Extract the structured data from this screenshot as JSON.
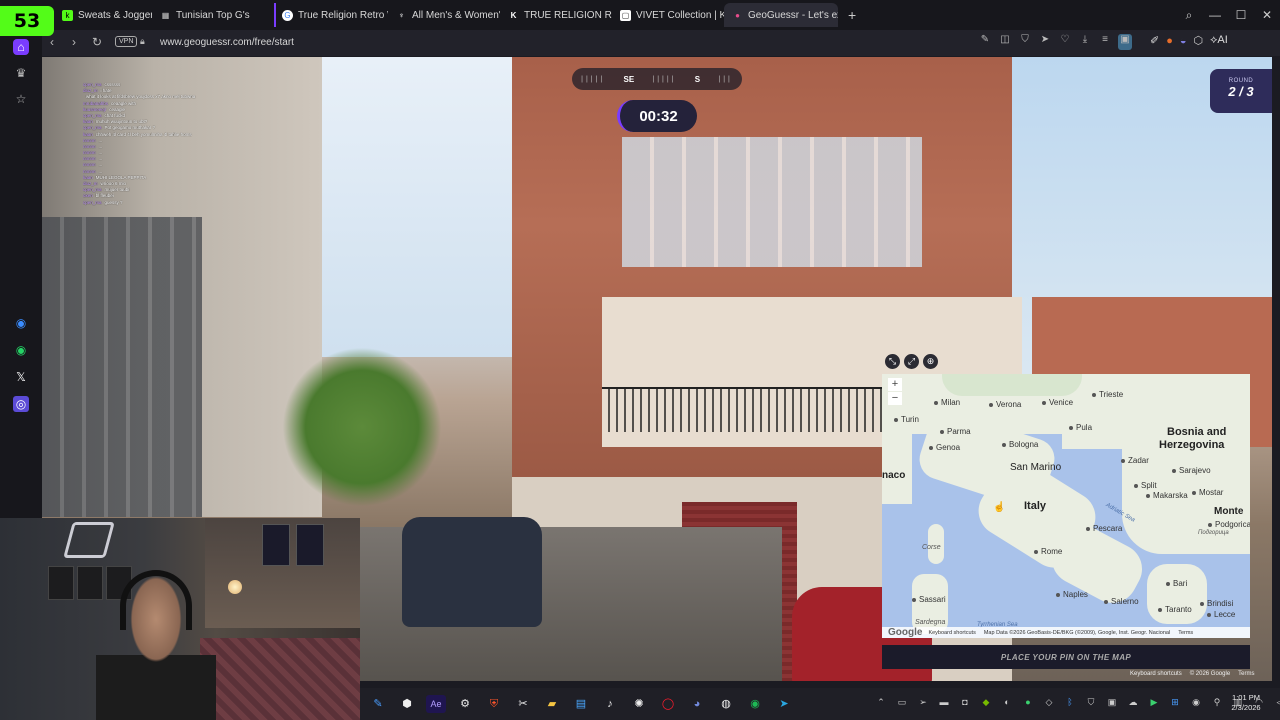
{
  "browser": {
    "badge": "53",
    "tabs": [
      {
        "label": "Sweats & Joggers",
        "icon": "kick-icon",
        "active": false
      },
      {
        "label": "Tunisian Top G's",
        "icon": "grid-icon",
        "active": false
      },
      {
        "label": "True Religion Retro Wool",
        "icon": "google-icon",
        "active": false
      },
      {
        "label": "All Men's & Women's Clot",
        "icon": "shop-icon",
        "active": false
      },
      {
        "label": "TRUE RELIGION Retro Wo",
        "icon": "k-icon",
        "active": false
      },
      {
        "label": "VIVET Collection | Kai Cen",
        "icon": "store-icon",
        "active": false
      },
      {
        "label": "GeoGuessr - Let's expl",
        "icon": "geoguessr-icon",
        "active": true
      }
    ],
    "new_tab": "+",
    "vpn": "VPN",
    "url": "www.geoguessr.com/free/start",
    "ai_label": "AI"
  },
  "game": {
    "compass_left": "SE",
    "compass_right": "S",
    "timer": "00:32",
    "round_label": "ROUND",
    "round_value": "2 / 3",
    "place_pin": "PLACE YOUR PIN ON THE MAP",
    "sv_footer": [
      "Keyboard shortcuts",
      "© 2026 Google",
      "Terms"
    ]
  },
  "map": {
    "zoom_in": "+",
    "zoom_out": "−",
    "cities": [
      {
        "name": "Milan"
      },
      {
        "name": "Verona"
      },
      {
        "name": "Venice"
      },
      {
        "name": "Trieste"
      },
      {
        "name": "Turin"
      },
      {
        "name": "Parma"
      },
      {
        "name": "Bologna"
      },
      {
        "name": "Genoa"
      },
      {
        "name": "Pula"
      },
      {
        "name": "Zadar"
      },
      {
        "name": "Sarajevo"
      },
      {
        "name": "Split"
      },
      {
        "name": "Makarska"
      },
      {
        "name": "Mostar"
      },
      {
        "name": "Pescara"
      },
      {
        "name": "Rome"
      },
      {
        "name": "Bari"
      },
      {
        "name": "Naples"
      },
      {
        "name": "Salerno"
      },
      {
        "name": "Sassari"
      },
      {
        "name": "Brindisi"
      },
      {
        "name": "Lecce"
      },
      {
        "name": "Taranto"
      },
      {
        "name": "Podgorica"
      }
    ],
    "labels": {
      "san_marino": "San Marino",
      "italy": "Italy",
      "bosnia": "Bosnia and",
      "herzegovina": "Herzegovina",
      "monte": "Monte",
      "naco": "naco",
      "corse": "Corse",
      "sardegna": "Sardegna",
      "adriatic": "Adriatic Sea",
      "tyrrhenian": "Tyrrhenian Sea",
      "podgorica_cyr": "Подгорица"
    },
    "footer": {
      "google": "Google",
      "shortcuts": "Keyboard shortcuts",
      "data": "Map Data ©2026 GeoBasis-DE/BKG (©2009), Google, Inst. Geogr. Nacional",
      "terms": "Terms"
    }
  },
  "chat": [
    {
      "user": "cpen_ma",
      "msg": "cssssss"
    },
    {
      "user": "diuz_m",
      "msg": "i hate"
    },
    {
      "user": "",
      "msg": "what it looks at fifdsbrew youjdoss x7 akno mel tubwna"
    },
    {
      "user": "mrubanahbs",
      "msg": "ceaagle with"
    },
    {
      "user": "kuusmeeejr",
      "msg": "ceaagle"
    },
    {
      "user": "cpen_ma",
      "msg": "chat fuckd"
    },
    {
      "user": "kaan",
      "msg": "muhuh wuujintoun to ubt?"
    },
    {
      "user": "cpen_ma",
      "msg": "Pot geogamo muthakar ?"
    },
    {
      "user": "kaan",
      "msg": "chhweh 4l card 4l beh yomulmiha 4l tahlie homs"
    },
    {
      "user": "nnnnn",
      "msg": "..."
    },
    {
      "user": "nnnnn",
      "msg": "..."
    },
    {
      "user": "nnnnn",
      "msg": "..."
    },
    {
      "user": "nnnnn",
      "msg": "..."
    },
    {
      "user": "nnnnn",
      "msg": "..."
    },
    {
      "user": "nnnnn",
      "msg": "..."
    },
    {
      "user": "kaan",
      "msg": "MUHI LEGOLA PEPPITA"
    },
    {
      "user": "diuz_m",
      "msg": "wriooo 6 mlo"
    },
    {
      "user": "cpen_ma",
      "msg": "mujuer tuubi"
    },
    {
      "user": "oxen",
      "msg": "bl fleubei"
    },
    {
      "user": "cpen_ma",
      "msg": "guessy ?"
    }
  ],
  "taskbar": {
    "time": "1:01 PM",
    "date": "2/3/2026",
    "apps": [
      "pin-icon",
      "cube-icon",
      "ae-icon",
      "settings-icon",
      "brave-icon",
      "capcut-icon",
      "files-icon",
      "notes-icon",
      "tiktok-icon",
      "chatgpt-icon",
      "opera-icon",
      "discord-icon",
      "app-icon",
      "spotify-icon",
      "telegram-icon"
    ]
  },
  "colors": {
    "kick_green": "#53fc18",
    "geoguessr_purple": "#7a3cff",
    "round_bg": "#2e2c5a"
  }
}
